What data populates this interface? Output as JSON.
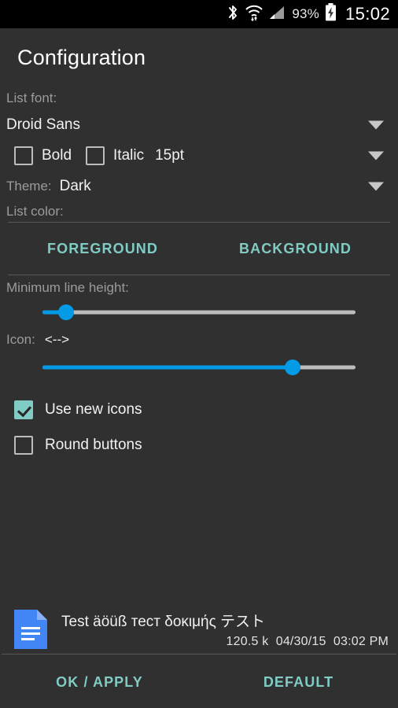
{
  "statusbar": {
    "icons": [
      "bluetooth-icon",
      "wifi-icon",
      "cell-signal-icon",
      "battery-charging-icon"
    ],
    "battery_percent": "93%",
    "clock": "15:02"
  },
  "header": {
    "title": "Configuration"
  },
  "settings": {
    "list_font_label": "List font:",
    "font_name": "Droid Sans",
    "bold_label": "Bold",
    "bold_checked": false,
    "italic_label": "Italic",
    "italic_checked": false,
    "font_size": "15pt",
    "theme_label": "Theme:",
    "theme_value": "Dark",
    "list_color_label": "List color:",
    "foreground_button": "FOREGROUND",
    "background_button": "BACKGROUND",
    "min_line_height_label": "Minimum line height:",
    "min_line_height_percent": 7.5,
    "icon_label": "Icon:",
    "icon_value": "<-->",
    "icon_size_percent": 80,
    "use_new_icons_label": "Use new icons",
    "use_new_icons_checked": true,
    "round_buttons_label": "Round buttons",
    "round_buttons_checked": false
  },
  "preview": {
    "icon": "document-icon",
    "title": "Test äöüß тест δοκιμής テスト",
    "size": "120.5 k",
    "date": "04/30/15",
    "time": "03:02 PM"
  },
  "footer": {
    "ok_apply": "OK / APPLY",
    "default": "DEFAULT"
  },
  "colors": {
    "accent_teal": "#80cbc4",
    "slider_blue": "#039BE5",
    "background": "#303030",
    "doc_icon_blue": "#4285F4"
  }
}
